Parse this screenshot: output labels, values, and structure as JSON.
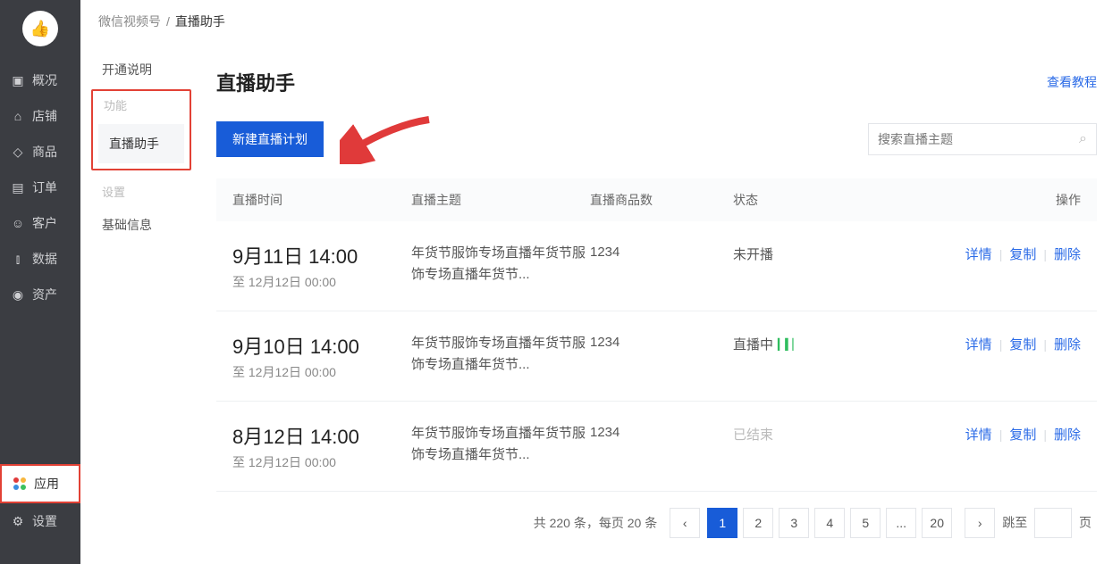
{
  "breadcrumb": {
    "root": "微信视频号",
    "sep": "/",
    "current": "直播助手"
  },
  "leftnav": {
    "items": [
      {
        "label": "概况"
      },
      {
        "label": "店铺"
      },
      {
        "label": "商品"
      },
      {
        "label": "订单"
      },
      {
        "label": "客户"
      },
      {
        "label": "数据"
      },
      {
        "label": "资产"
      },
      {
        "label": "应用"
      },
      {
        "label": "设置"
      }
    ]
  },
  "sidemenu": {
    "section1": "开通说明",
    "group1": "功能",
    "active": "直播助手",
    "group2": "设置",
    "item2": "基础信息"
  },
  "page": {
    "title": "直播助手",
    "tutorial": "查看教程",
    "new_btn": "新建直播计划",
    "search_placeholder": "搜索直播主题"
  },
  "table": {
    "headers": {
      "time": "直播时间",
      "topic": "直播主题",
      "count": "直播商品数",
      "status": "状态",
      "action": "操作"
    },
    "actions": {
      "detail": "详情",
      "copy": "复制",
      "delete": "删除"
    },
    "rows": [
      {
        "dt": "9月11日 14:00",
        "dtend": "至 12月12日 00:00",
        "topic": "年货节服饰专场直播年货节服饰专场直播年货节...",
        "count": "1234",
        "status": "未开播",
        "status_kind": "not_started"
      },
      {
        "dt": "9月10日 14:00",
        "dtend": "至 12月12日 00:00",
        "topic": "年货节服饰专场直播年货节服饰专场直播年货节...",
        "count": "1234",
        "status": "直播中",
        "status_kind": "live"
      },
      {
        "dt": "8月12日 14:00",
        "dtend": "至 12月12日 00:00",
        "topic": "年货节服饰专场直播年货节服饰专场直播年货节...",
        "count": "1234",
        "status": "已结束",
        "status_kind": "ended"
      }
    ]
  },
  "pager": {
    "info": "共 220 条，每页 20 条",
    "pages": [
      "1",
      "2",
      "3",
      "4",
      "5",
      "...",
      "20"
    ],
    "active": "1",
    "jump_prefix": "跳至",
    "jump_suffix": "页"
  }
}
